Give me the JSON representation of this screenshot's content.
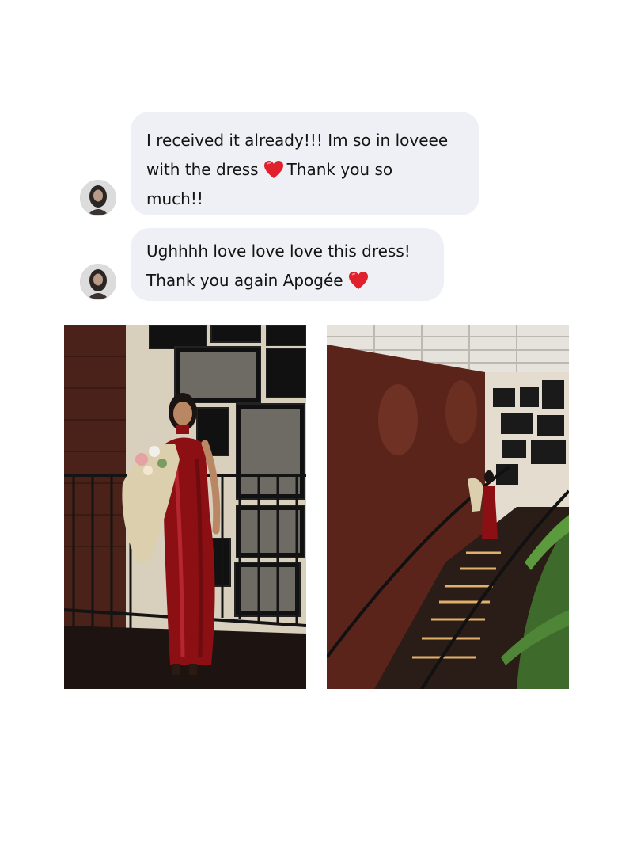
{
  "messages": [
    {
      "sender": "customer",
      "line1": "I received it already!!! Im so in loveee",
      "line2a": "with the dress",
      "line2b": "Thank you so",
      "line3": "much!!"
    },
    {
      "sender": "customer",
      "line1": "Ughhhh love love love this dress!",
      "line2": "Thank you again Apogée"
    }
  ],
  "icons": {
    "emoji": "red-heart-icon",
    "avatar": "avatar-photo"
  },
  "colors": {
    "bubble": "#eff0f5",
    "text": "#141414",
    "heart": "#e0202a",
    "dress": "#8c0f14"
  }
}
